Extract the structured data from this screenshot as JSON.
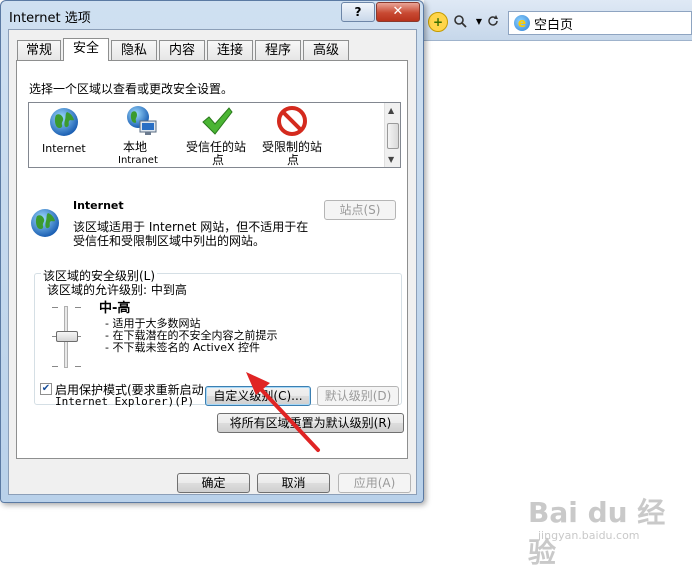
{
  "browser": {
    "address": "空白页"
  },
  "dialog": {
    "title": "Internet 选项",
    "help_label": "?",
    "close_label": "✕"
  },
  "tabs": [
    {
      "label": "常规"
    },
    {
      "label": "安全"
    },
    {
      "label": "隐私"
    },
    {
      "label": "内容"
    },
    {
      "label": "连接"
    },
    {
      "label": "程序"
    },
    {
      "label": "高级"
    }
  ],
  "security": {
    "instruction": "选择一个区域以查看或更改安全设置。",
    "zones": [
      {
        "label": "Internet",
        "icon": "globe-icon"
      },
      {
        "label_line1": "本地",
        "label_line2": "Intranet",
        "icon": "local-intranet-icon"
      },
      {
        "label_line1": "受信任的站",
        "label_line2": "点",
        "icon": "checkmark-icon"
      },
      {
        "label_line1": "受限制的站",
        "label_line2": "点",
        "icon": "restricted-icon"
      }
    ],
    "selected_zone_name": "Internet",
    "zone_desc_line1": "该区域适用于 Internet 网站，但不适用于在",
    "zone_desc_line2": "受信任和受限制区域中列出的网站。",
    "sites_button": "站点(S)",
    "group_title": "该区域的安全级别(L)",
    "allowed_levels": "该区域的允许级别: 中到高",
    "level_name": "中-高",
    "level_bullets": [
      "- 适用于大多数网站",
      "- 在下载潜在的不安全内容之前提示",
      "- 不下载未签名的 ActiveX 控件"
    ],
    "protected_mode_line1": "启用保护模式(要求重新启动",
    "protected_mode_line2": "Internet Explorer)(P)",
    "protected_mode_checked": true,
    "custom_level_button": "自定义级别(C)...",
    "default_level_button": "默认级别(D)",
    "reset_all_button": "将所有区域重置为默认级别(R)"
  },
  "footer": {
    "ok": "确定",
    "cancel": "取消",
    "apply": "应用(A)"
  },
  "watermark": {
    "text": "Bai du 经验",
    "sub": "jingyan.baidu.com"
  },
  "colors": {
    "annotation_arrow": "#e02424",
    "title_bar": "#c6d9ee"
  }
}
